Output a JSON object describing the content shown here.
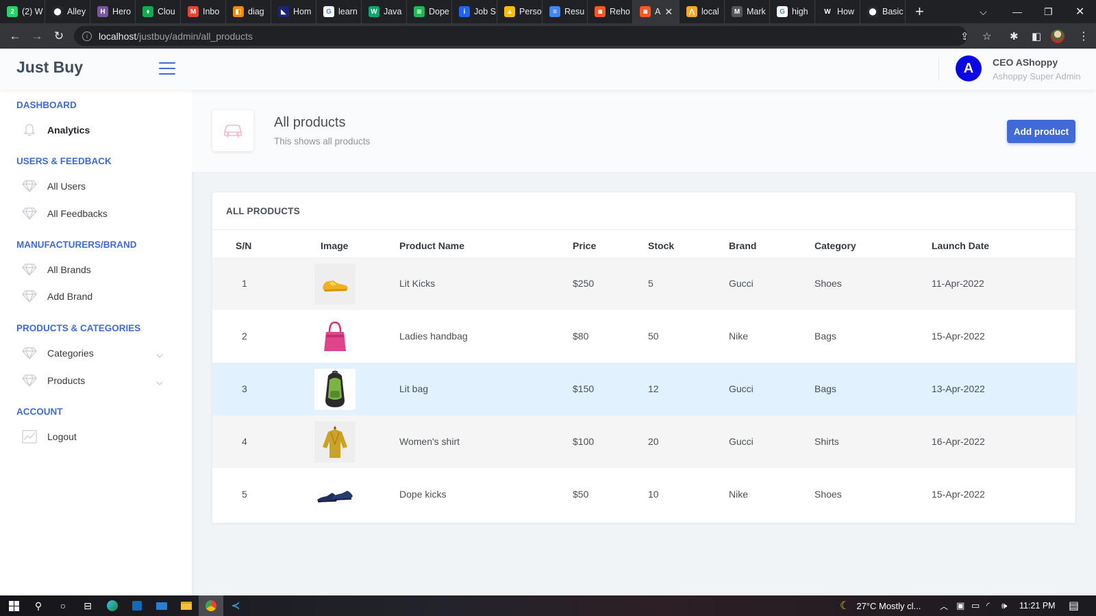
{
  "browser": {
    "tabs": [
      {
        "label": "(2) W",
        "fav": "whatsapp-icon",
        "color": "#25d366",
        "glyph": "2"
      },
      {
        "label": "Alley",
        "fav": "github-icon",
        "color": "#24292e",
        "glyph": "⬤"
      },
      {
        "label": "Hero",
        "fav": "heroku-icon",
        "color": "#79589f",
        "glyph": "H"
      },
      {
        "label": "Clou",
        "fav": "mongodb-icon",
        "color": "#13aa52",
        "glyph": "♦"
      },
      {
        "label": "Inbo",
        "fav": "gmail-icon",
        "color": "#ea4335",
        "glyph": "M"
      },
      {
        "label": "diag",
        "fav": "drawio-icon",
        "color": "#f08705",
        "glyph": "◧"
      },
      {
        "label": "Hom",
        "fav": "app-icon",
        "color": "#1a237e",
        "glyph": "◣"
      },
      {
        "label": "learn",
        "fav": "google-icon",
        "color": "#ffffff",
        "glyph": "G"
      },
      {
        "label": "Java",
        "fav": "w3schools-icon",
        "color": "#04aa6d",
        "glyph": "W"
      },
      {
        "label": "Dope",
        "fav": "spotify-icon",
        "color": "#1db954",
        "glyph": "≋"
      },
      {
        "label": "Job S",
        "fav": "indeed-icon",
        "color": "#2164f3",
        "glyph": "i"
      },
      {
        "label": "Perso",
        "fav": "google-drive-icon",
        "color": "#fbbc04",
        "glyph": "▲"
      },
      {
        "label": "Resu",
        "fav": "google-docs-icon",
        "color": "#4285f4",
        "glyph": "≡"
      },
      {
        "label": "Reho",
        "fav": "app-icon",
        "color": "#ff5722",
        "glyph": "◙"
      },
      {
        "label": "A",
        "fav": "app-icon",
        "color": "#ff5722",
        "glyph": "◙",
        "active": true
      },
      {
        "label": "local",
        "fav": "app-icon",
        "color": "#f9a825",
        "glyph": "⋀"
      },
      {
        "label": "Mark",
        "fav": "markdown-icon",
        "color": "#555555",
        "glyph": "M"
      },
      {
        "label": "high",
        "fav": "google-icon",
        "color": "#ffffff",
        "glyph": "G"
      },
      {
        "label": "How",
        "fav": "wikipedia-icon",
        "color": "#202124",
        "glyph": "W"
      },
      {
        "label": "Basic",
        "fav": "github-icon",
        "color": "#24292e",
        "glyph": "⬤"
      }
    ],
    "new_tab": "+",
    "url_host": "localhost",
    "url_path": "/justbuy/admin/all_products"
  },
  "header": {
    "brand": "Just Buy",
    "user_initial": "A",
    "user_name": "CEO AShoppy",
    "user_role": "Ashoppy Super Admin"
  },
  "sidebar": {
    "sections": [
      {
        "heading": "DASHBOARD",
        "items": [
          {
            "label": "Analytics",
            "icon": "bell-icon",
            "bold": true
          }
        ]
      },
      {
        "heading": "USERS & FEEDBACK",
        "items": [
          {
            "label": "All Users",
            "icon": "diamond-icon"
          },
          {
            "label": "All Feedbacks",
            "icon": "diamond-icon"
          }
        ]
      },
      {
        "heading": "MANUFACTURERS/BRAND",
        "items": [
          {
            "label": "All Brands",
            "icon": "diamond-icon"
          },
          {
            "label": "Add Brand",
            "icon": "diamond-icon"
          }
        ]
      },
      {
        "heading": "PRODUCTS & CATEGORIES",
        "items": [
          {
            "label": "Categories",
            "icon": "diamond-icon",
            "chevron": true
          },
          {
            "label": "Products",
            "icon": "diamond-icon",
            "chevron": true
          }
        ]
      },
      {
        "heading": "ACCOUNT",
        "items": [
          {
            "label": "Logout",
            "icon": "chart-icon"
          }
        ]
      }
    ]
  },
  "page": {
    "title": "All products",
    "subtitle": "This shows all products",
    "add_button": "Add product",
    "icon": "car-icon"
  },
  "table": {
    "card_title": "ALL PRODUCTS",
    "columns": [
      "S/N",
      "Image",
      "Product Name",
      "Price",
      "Stock",
      "Brand",
      "Category",
      "Launch Date"
    ],
    "rows": [
      {
        "sn": "1",
        "image": "yellow-sneaker",
        "name": "Lit Kicks",
        "price": "$250",
        "stock": "5",
        "brand": "Gucci",
        "category": "Shoes",
        "launch": "11-Apr-2022"
      },
      {
        "sn": "2",
        "image": "pink-handbag",
        "name": "Ladies handbag",
        "price": "$80",
        "stock": "50",
        "brand": "Nike",
        "category": "Bags",
        "launch": "15-Apr-2022"
      },
      {
        "sn": "3",
        "image": "green-backpack",
        "name": "Lit bag",
        "price": "$150",
        "stock": "12",
        "brand": "Gucci",
        "category": "Bags",
        "launch": "13-Apr-2022"
      },
      {
        "sn": "4",
        "image": "mustard-shirt",
        "name": "Women's shirt",
        "price": "$100",
        "stock": "20",
        "brand": "Gucci",
        "category": "Shirts",
        "launch": "16-Apr-2022"
      },
      {
        "sn": "5",
        "image": "navy-shoes",
        "name": "Dope kicks",
        "price": "$50",
        "stock": "10",
        "brand": "Nike",
        "category": "Shoes",
        "launch": "15-Apr-2022"
      }
    ]
  },
  "taskbar": {
    "weather": "27°C  Mostly cl...",
    "time": "11:21 PM"
  },
  "colors": {
    "accent": "#3f6ad8",
    "avatar": "#0b06e6",
    "row_alt": "#f5f5f5",
    "row_hover": "#e1f1fd"
  }
}
